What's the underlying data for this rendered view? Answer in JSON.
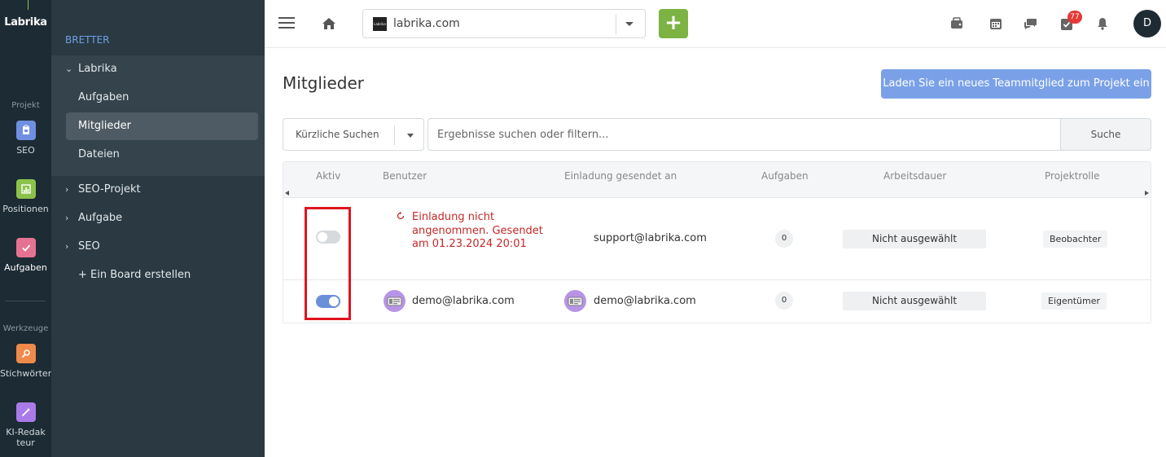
{
  "rail": {
    "logo": "Labrika",
    "section_project": "Projekt",
    "section_tools": "Werkzeuge",
    "items": [
      {
        "label": "SEO",
        "color": "#6f8fe0",
        "icon": "clipboard-icon"
      },
      {
        "label": "Positionen",
        "color": "#8bc34a",
        "icon": "chart-icon"
      },
      {
        "label": "Aufgaben",
        "color": "#e57390",
        "icon": "check-icon"
      },
      {
        "label": "Stichwörter",
        "color": "#f08a4b",
        "icon": "key-search-icon"
      },
      {
        "label": "KI-Redakteur",
        "color": "#a97be8",
        "icon": "magic-wand-icon"
      }
    ]
  },
  "boards": {
    "heading": "BRETTER",
    "group_title": "Labrika",
    "group_items": [
      "Aufgaben",
      "Mitglieder",
      "Dateien"
    ],
    "other": [
      "SEO-Projekt",
      "Aufgabe",
      "SEO"
    ],
    "create": "+ Ein Board erstellen"
  },
  "topbar": {
    "project": "labrika.com",
    "project_logo_text": "Labrika",
    "add_label": "+",
    "badge_count": "77",
    "avatar_initial": "D"
  },
  "main": {
    "title": "Mitglieder",
    "invite_button": "Laden Sie ein neues Teammitglied zum Projekt ein",
    "recent_searches": "Kürzliche Suchen",
    "search_placeholder": "Ergebnisse suchen oder filtern...",
    "search_button": "Suche"
  },
  "table": {
    "headers": [
      "Aktiv",
      "Benutzer",
      "Einladung gesendet an",
      "Aufgaben",
      "Arbeitsdauer",
      "Projektrolle"
    ],
    "rows": [
      {
        "active": false,
        "user_status": "Einladung nicht angenommen. Gesendet am 01.23.2024 20:01",
        "invite_sent_to": "support@labrika.com",
        "tasks": "0",
        "duration": "Nicht ausgewählt",
        "role": "Beobachter"
      },
      {
        "active": true,
        "user": "demo@labrika.com",
        "invite_sent_to": "demo@labrika.com",
        "tasks": "0",
        "duration": "Nicht ausgewählt",
        "role": "Eigentümer"
      }
    ]
  }
}
